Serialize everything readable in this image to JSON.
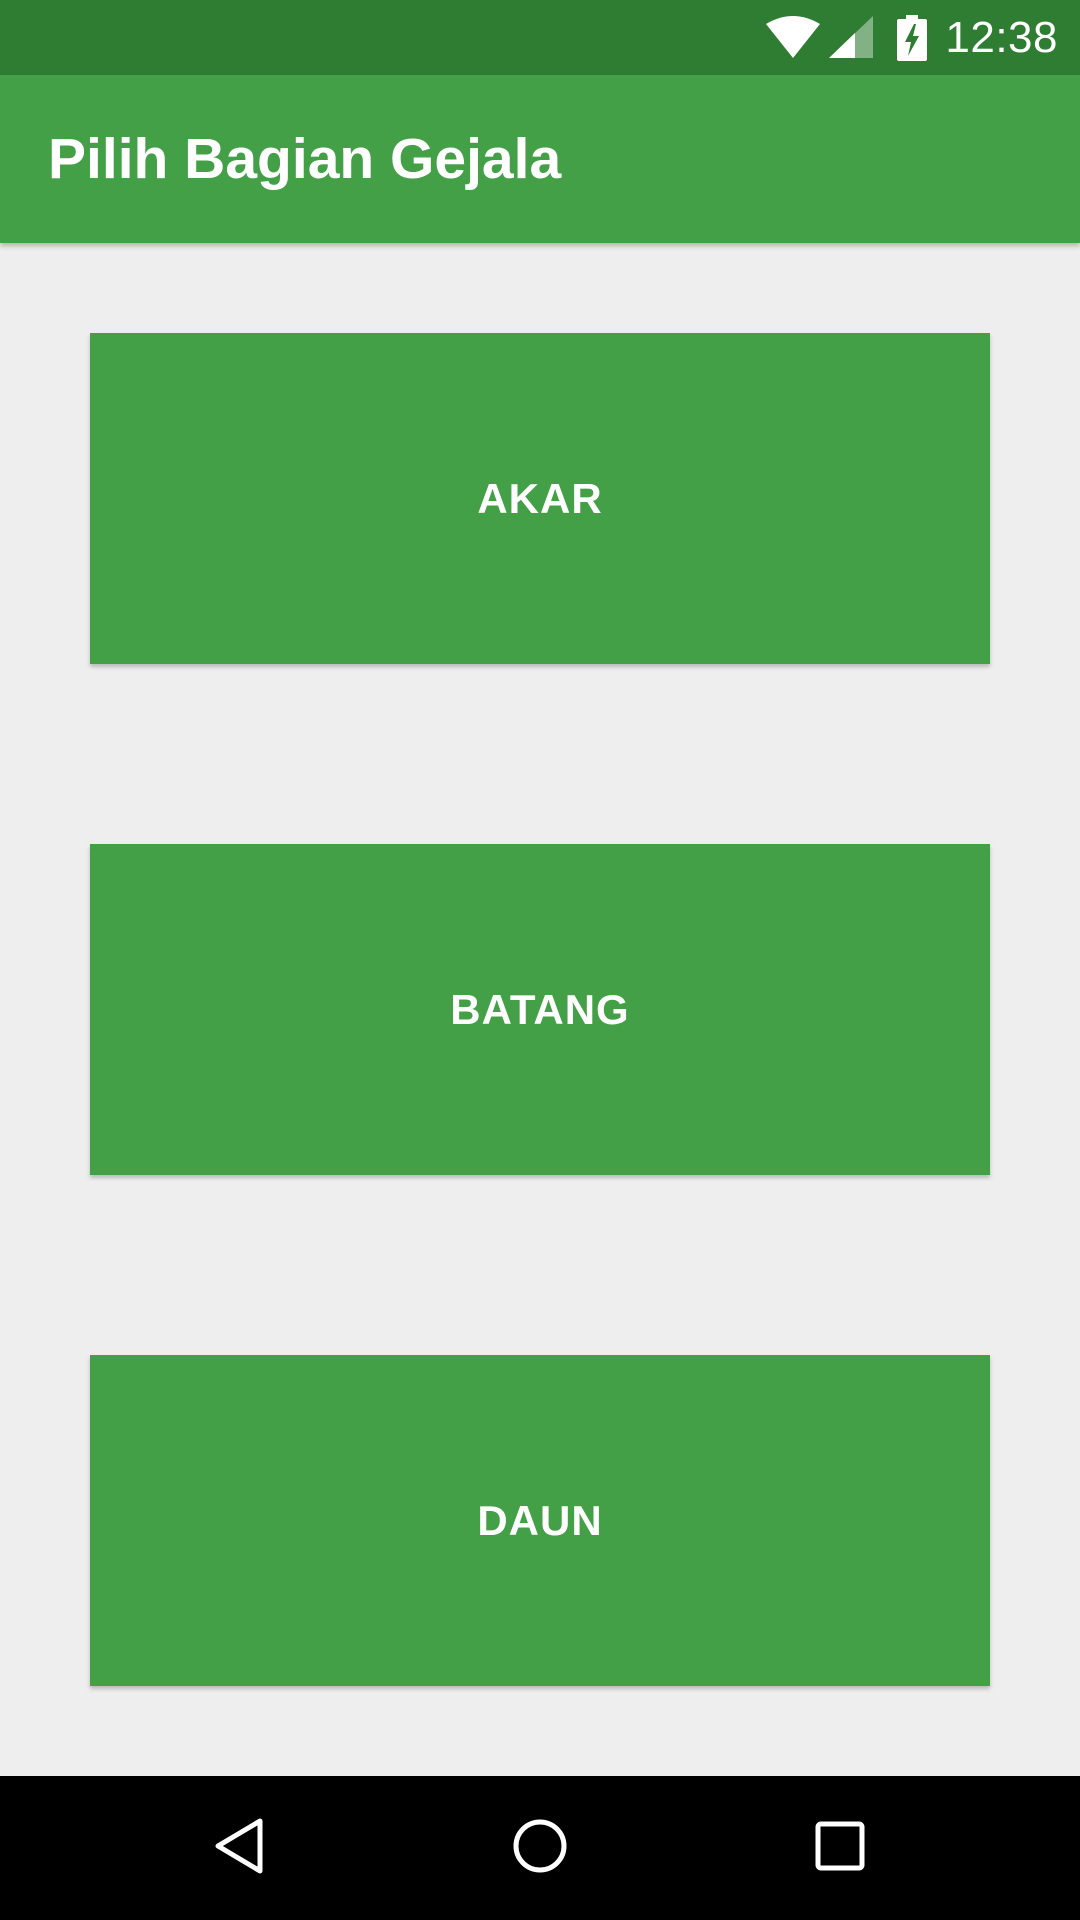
{
  "status_bar": {
    "time": "12:38",
    "icons": [
      "wifi-icon",
      "cell-signal-icon",
      "battery-charging-icon"
    ]
  },
  "app_bar": {
    "title": "Pilih Bagian Gejala"
  },
  "buttons": [
    {
      "label": "AKAR"
    },
    {
      "label": "BATANG"
    },
    {
      "label": "DAUN"
    }
  ],
  "nav_bar": {
    "icons": [
      "back-icon",
      "home-icon",
      "recents-icon"
    ]
  },
  "colors": {
    "status_bar": "#2e7d32",
    "primary": "#43a047",
    "background": "#eeeeee",
    "nav_bar": "#000000",
    "on_primary": "#ffffff"
  }
}
